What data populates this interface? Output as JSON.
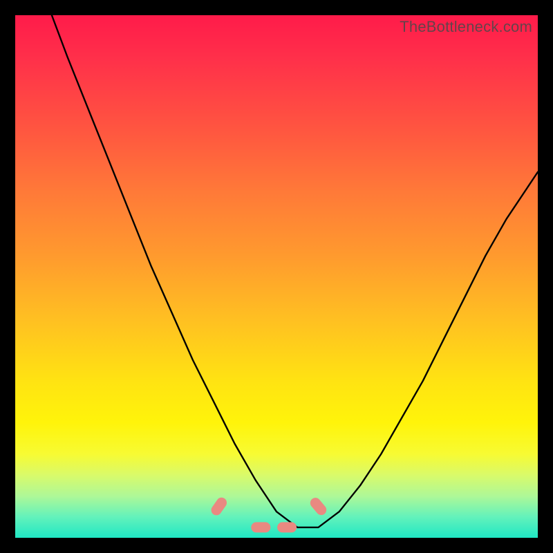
{
  "watermark": "TheBottleneck.com",
  "chart_data": {
    "type": "line",
    "title": "",
    "xlabel": "",
    "ylabel": "",
    "xlim": [
      0,
      100
    ],
    "ylim": [
      0,
      100
    ],
    "grid": false,
    "legend": false,
    "markers": {
      "shape": "rounded-pill",
      "color": "#e98981",
      "positions_x": [
        39,
        47,
        52,
        58
      ],
      "positions_y": [
        6,
        2,
        2,
        6
      ]
    },
    "series": [
      {
        "name": "curve",
        "color": "#000000",
        "x": [
          7,
          10,
          14,
          18,
          22,
          26,
          30,
          34,
          38,
          42,
          46,
          50,
          54,
          58,
          62,
          66,
          70,
          74,
          78,
          82,
          86,
          90,
          94,
          98,
          100
        ],
        "y": [
          100,
          92,
          82,
          72,
          62,
          52,
          43,
          34,
          26,
          18,
          11,
          5,
          2,
          2,
          5,
          10,
          16,
          23,
          30,
          38,
          46,
          54,
          61,
          67,
          70
        ]
      }
    ]
  },
  "colors": {
    "frame": "#000000",
    "curve": "#000000",
    "markers": "#e98981",
    "watermark": "#4a4a4a"
  }
}
